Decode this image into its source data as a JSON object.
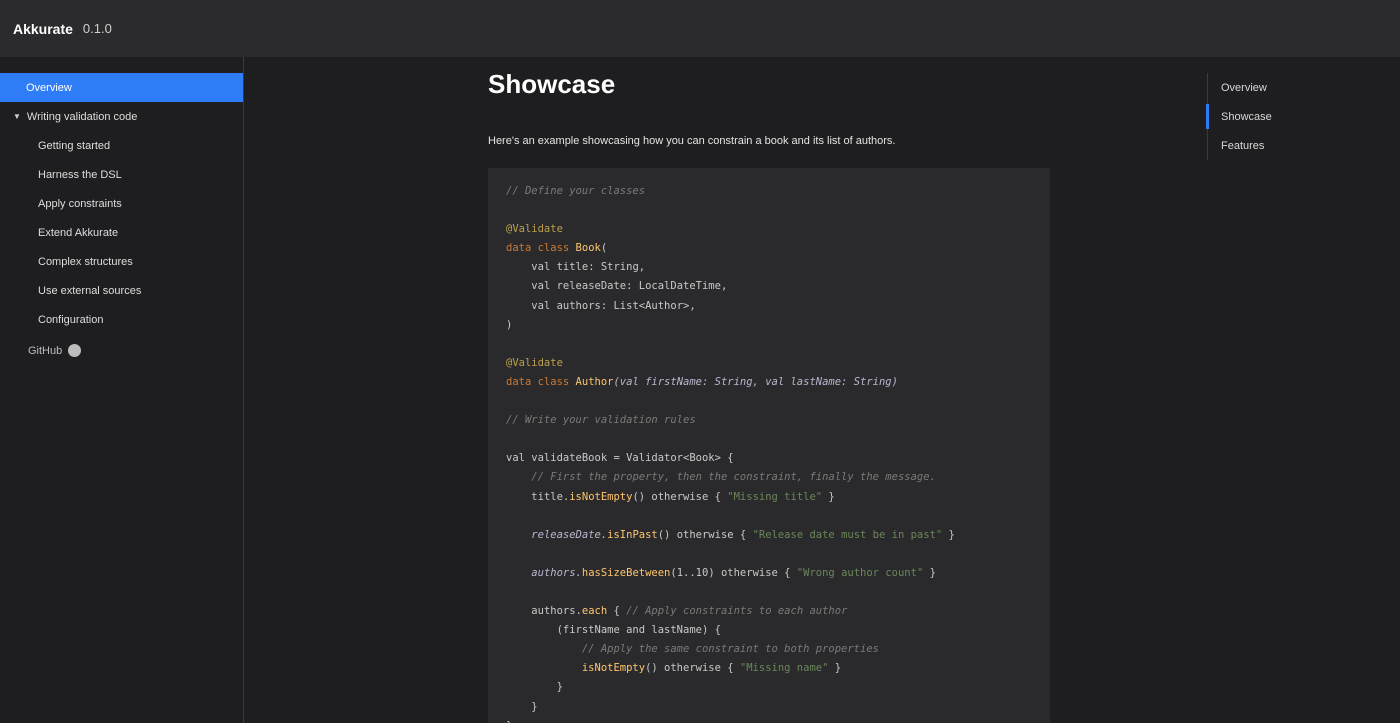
{
  "header": {
    "brand": "Akkurate",
    "version": "0.1.0"
  },
  "sidebar": {
    "overview": "Overview",
    "group": "Writing validation code",
    "items": [
      "Getting started",
      "Harness the DSL",
      "Apply constraints",
      "Extend Akkurate",
      "Complex structures",
      "Use external sources",
      "Configuration"
    ],
    "github": "GitHub",
    "github_icon": "github-icon"
  },
  "main": {
    "title": "Showcase",
    "intro": "Here's an example showcasing how you can constrain a book and its list of authors."
  },
  "toc": {
    "items": [
      "Overview",
      "Showcase",
      "Features"
    ],
    "active": "Showcase"
  },
  "code": {
    "comment_define": "// Define your classes",
    "annotation": "@Validate",
    "class1_kw": "data class",
    "class1_name": "Book",
    "prop1": "val title: String,",
    "prop2": "val releaseDate: LocalDateTime,",
    "prop3": "val authors: List<Author>,",
    "close_paren": ")",
    "class2_kw": "data class",
    "class2_name": "Author",
    "class2_params": "(val firstName: String, val lastName: String)",
    "comment_rules": "// Write your validation rules",
    "validator_line": "val validateBook = Validator<Book> {",
    "comment_first": "// First the property, then the constraint, finally the message.",
    "title_rule_prop": "title.",
    "title_rule_fn": "isNotEmpty",
    "title_rule_mid": "() otherwise { ",
    "title_rule_str": "\"Missing title\"",
    "title_rule_end": " }",
    "date_rule_prop": "releaseDate.",
    "date_rule_fn": "isInPast",
    "date_rule_mid": "() otherwise { ",
    "date_rule_str": "\"Release date must be in past\"",
    "date_rule_end": " }",
    "authors_rule_prop": "authors.",
    "authors_rule_fn": "hasSizeBetween",
    "authors_rule_mid": "(1..10) otherwise { ",
    "authors_rule_str": "\"Wrong author count\"",
    "authors_rule_end": " }",
    "each_prop": "authors.",
    "each_fn": "each",
    "each_mid": " { ",
    "each_comment": "// Apply constraints to each author",
    "group_line": "(firstName and lastName) {",
    "comment_same": "// Apply the same constraint to both properties",
    "name_rule_fn": "isNotEmpty",
    "name_rule_mid": "() otherwise { ",
    "name_rule_str": "\"Missing name\"",
    "name_rule_end": " }",
    "brace": "}"
  },
  "colors": {
    "accent": "#2f7df6",
    "background": "#1e1e20",
    "code_bg": "#2a2a2c"
  }
}
